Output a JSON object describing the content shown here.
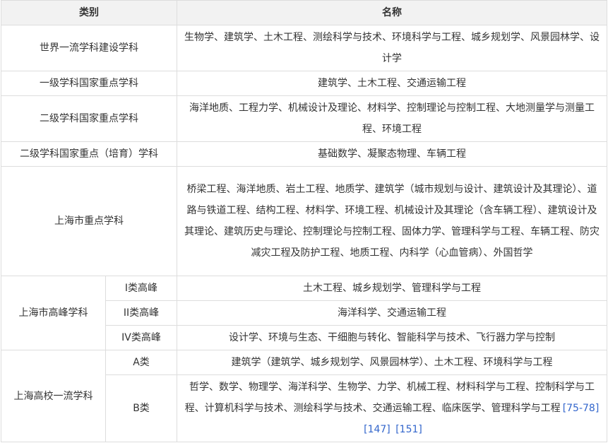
{
  "header": {
    "category": "类别",
    "name": "名称"
  },
  "rows": {
    "world_class": {
      "category": "世界一流学科建设学科",
      "name": "生物学、建筑学、土木工程、测绘科学与技术、环境科学与工程、城乡规划学、风景园林学、设计学"
    },
    "national_first": {
      "category": "一级学科国家重点学科",
      "name": "建筑学、土木工程、交通运输工程"
    },
    "national_second": {
      "category": "二级学科国家重点学科",
      "name": "海洋地质、工程力学、机械设计及理论、材料学、控制理论与控制工程、大地测量学与测量工程、环境工程"
    },
    "national_second_cultivation": {
      "category": "二级学科国家重点（培育）学科",
      "name": "基础数学、凝聚态物理、车辆工程"
    },
    "shanghai_key": {
      "category": "上海市重点学科",
      "name": "桥梁工程、海洋地质、岩土工程、地质学、建筑学（城市规划与设计、建筑设计及其理论）、道路与铁道工程、结构工程、材料学、环境工程、机械设计及其理论（含车辆工程）、建筑设计及其理论、建筑历史与理论、控制理论与控制工程、固体力学、管理科学与工程、车辆工程、防灾减灾工程及防护工程、地质工程、内科学（心血管病）、外国哲学"
    },
    "shanghai_peak": {
      "category": "上海市高峰学科",
      "sub": [
        {
          "label": "I类高峰",
          "name": "土木工程、城乡规划学、管理科学与工程"
        },
        {
          "label": "II类高峰",
          "name": "海洋科学、交通运输工程"
        },
        {
          "label": "IV类高峰",
          "name": "设计学、环境与生态、干细胞与转化、智能科学与技术、飞行器力学与控制"
        }
      ]
    },
    "shanghai_first_class": {
      "category": "上海高校一流学科",
      "sub": [
        {
          "label": "A类",
          "name": "建筑学（建筑学、城乡规划学、风景园林学）、土木工程、环境科学与工程"
        },
        {
          "label": "B类",
          "name": "哲学、数学、物理学、海洋科学、生物学、力学、机械工程、材料科学与工程、控制科学与工程、计算机科学与技术、测绘科学与技术、交通运输工程、临床医学、管理科学与工程"
        }
      ]
    }
  },
  "refs": [
    "[75-78]",
    "[147]",
    "[151]"
  ],
  "colors": {
    "border": "#dddddd",
    "header_bg": "#f2f2f2",
    "text": "#333333",
    "link": "#3366cc"
  }
}
